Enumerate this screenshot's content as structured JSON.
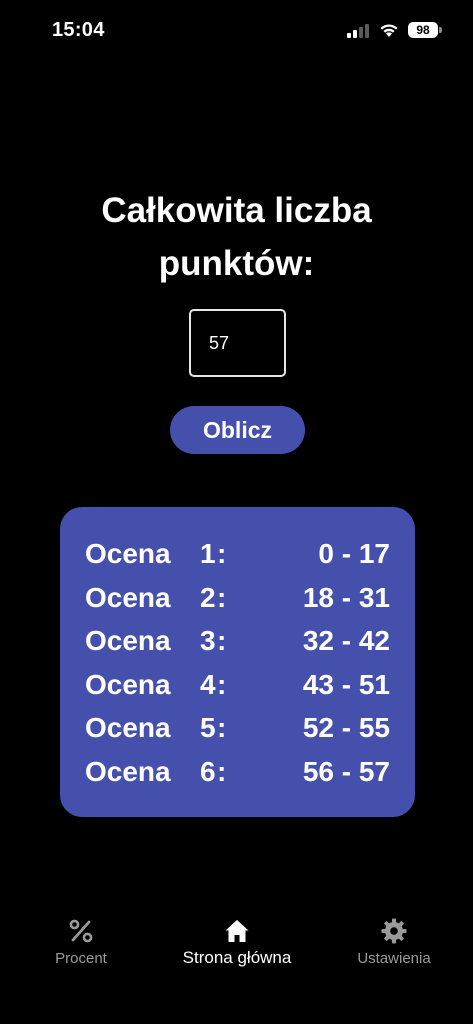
{
  "status_bar": {
    "time": "15:04",
    "battery": "98"
  },
  "main": {
    "title_line1": "Całkowita liczba",
    "title_line2": "punktów:",
    "points_value": "57",
    "calc_label": "Oblicz"
  },
  "grades": [
    {
      "word": "Ocena",
      "num": "1",
      "range": "0 - 17"
    },
    {
      "word": "Ocena",
      "num": "2",
      "range": "18 - 31"
    },
    {
      "word": "Ocena",
      "num": "3",
      "range": "32 - 42"
    },
    {
      "word": "Ocena",
      "num": "4",
      "range": "43 - 51"
    },
    {
      "word": "Ocena",
      "num": "5",
      "range": "52 - 55"
    },
    {
      "word": "Ocena",
      "num": "6",
      "range": "56 - 57"
    }
  ],
  "nav": {
    "items": [
      {
        "label": "Procent",
        "icon": "percent-icon",
        "active": false
      },
      {
        "label": "Strona główna",
        "icon": "home-icon",
        "active": true
      },
      {
        "label": "Ustawienia",
        "icon": "gear-icon",
        "active": false
      }
    ]
  },
  "colors": {
    "background": "#000000",
    "accent": "#4550ad",
    "inactive_nav": "#9a9a9a"
  }
}
